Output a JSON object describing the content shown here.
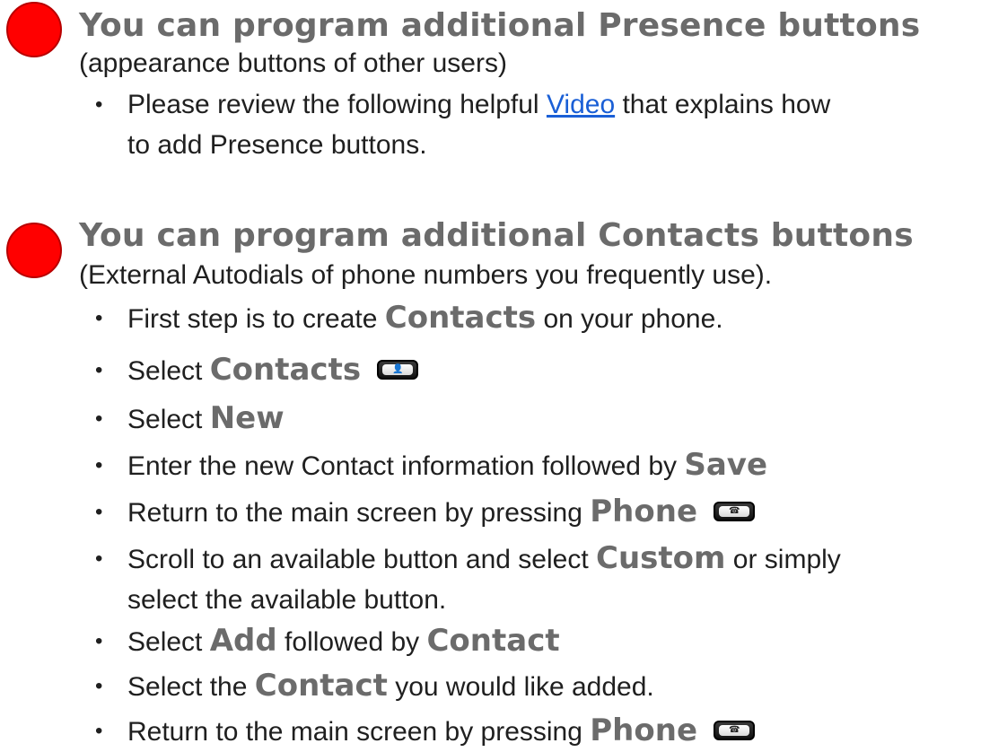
{
  "section1": {
    "heading": "You can program additional Presence buttons",
    "subtext": "(appearance buttons of other users)",
    "bullet_a_pre": "Please review the following helpful ",
    "bullet_a_link": "Video",
    "bullet_a_post": " that explains how",
    "bullet_a_line2": "to add Presence buttons."
  },
  "section2": {
    "heading": "You can program additional Contacts buttons",
    "subtext": "(External Autodials of phone numbers you frequently use).",
    "b1_pre": "First step is to create ",
    "b1_kw": "Contacts",
    "b1_post": " on your phone.",
    "b2_pre": "Select ",
    "b2_kw": "Contacts",
    "b3_pre": "Select ",
    "b3_kw": "New",
    "b4_pre": "Enter the new Contact information followed by ",
    "b4_kw": "Save",
    "b5_pre": "Return to the main screen by pressing ",
    "b5_kw": "Phone",
    "b6_pre": "Scroll to an available button and select ",
    "b6_kw": "Custom",
    "b6_post": " or simply",
    "b6_line2": "select the available button.",
    "b7_pre": "Select ",
    "b7_kw1": "Add",
    "b7_mid": " followed by ",
    "b7_kw2": "Contact",
    "b8_pre": "Select the ",
    "b8_kw": "Contact",
    "b8_post": " you would like added.",
    "b9_pre": "Return to the main screen by pressing ",
    "b9_kw": "Phone"
  },
  "icons": {
    "bullet": "•",
    "contacts_key_glyph": "👤",
    "phone_key_glyph": "☎"
  },
  "colors": {
    "heading": "#6b6b6b",
    "dot": "#ff0000",
    "link": "#1a5fd6"
  }
}
